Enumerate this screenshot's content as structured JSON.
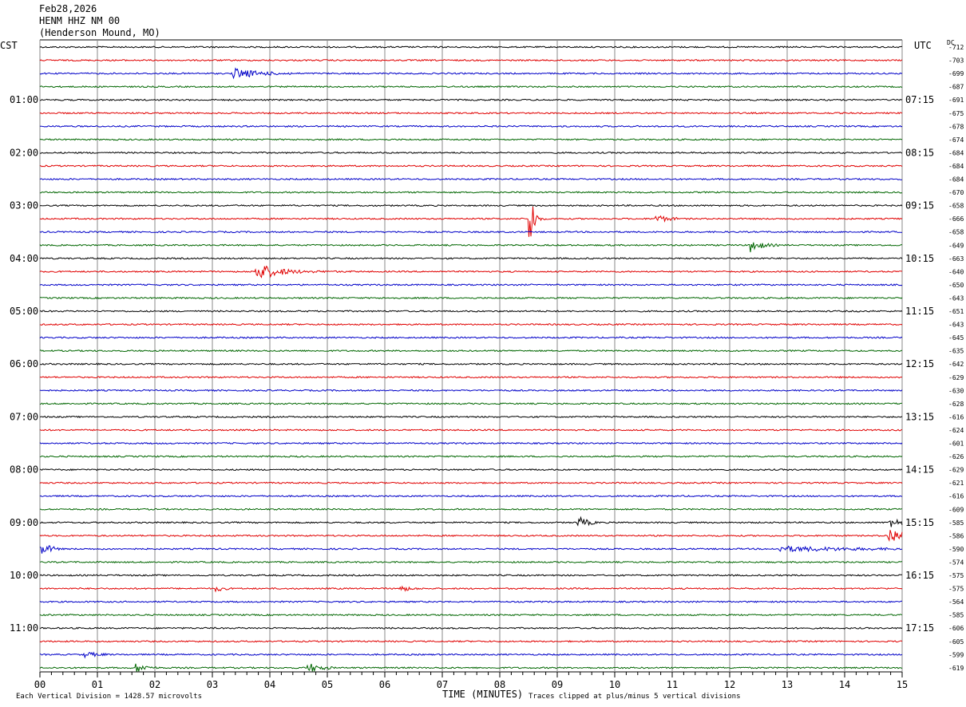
{
  "header": {
    "date": "Feb28,2026",
    "station": "HENM HHZ NM 00",
    "location": "(Henderson Mound, MO)"
  },
  "labels": {
    "left_tz": "CST",
    "right_tz": "UTC",
    "dc": "DC",
    "xlabel": "TIME (MINUTES)",
    "scale_note": "Each Vertical Division = 1428.57 microvolts",
    "clip_note": "Traces clipped at plus/minus 5 vertical divisions"
  },
  "chart_data": {
    "type": "line",
    "x_ticks": [
      "00",
      "01",
      "02",
      "03",
      "04",
      "05",
      "06",
      "07",
      "08",
      "09",
      "10",
      "11",
      "12",
      "13",
      "14",
      "15"
    ],
    "xlim": [
      0,
      15
    ],
    "trace_colors": [
      "#000000",
      "#e00000",
      "#0000c8",
      "#006600"
    ],
    "cst_hours": [
      "01:00",
      "02:00",
      "03:00",
      "04:00",
      "05:00",
      "06:00",
      "07:00",
      "08:00",
      "09:00",
      "10:00",
      "11:00"
    ],
    "utc_hours": [
      "07:15",
      "08:15",
      "09:15",
      "10:15",
      "11:15",
      "12:15",
      "13:15",
      "14:15",
      "15:15",
      "16:15",
      "17:15"
    ],
    "dc_offsets": [
      "-712",
      "-703",
      "-699",
      "-687",
      "-691",
      "-675",
      "-678",
      "-674",
      "-684",
      "-684",
      "-684",
      "-670",
      "-658",
      "-666",
      "-658",
      "-649",
      "-663",
      "-640",
      "-650",
      "-643",
      "-651",
      "-643",
      "-645",
      "-635",
      "-642",
      "-629",
      "-630",
      "-628",
      "-616",
      "-624",
      "-601",
      "-626",
      "-629",
      "-621",
      "-616",
      "-609",
      "-585",
      "-586",
      "-590",
      "-574",
      "-575",
      "-575",
      "-564",
      "-585",
      "-606",
      "-605",
      "-599",
      "-619"
    ],
    "events": [
      {
        "row": 2,
        "minute": 3.4,
        "amp": 6,
        "dur": 1.0,
        "decay": 0.4
      },
      {
        "row": 13,
        "minute": 8.55,
        "amp": 36,
        "dur": 0.25,
        "decay": 0.05
      },
      {
        "row": 13,
        "minute": 10.75,
        "amp": 4,
        "dur": 0.35,
        "decay": 0.2
      },
      {
        "row": 15,
        "minute": 12.4,
        "amp": 8,
        "dur": 0.45,
        "decay": 0.15
      },
      {
        "row": 17,
        "minute": 3.8,
        "amp": 10,
        "dur": 2.2,
        "decay": 0.35
      },
      {
        "row": 36,
        "minute": 9.4,
        "amp": 6,
        "dur": 0.35,
        "decay": 0.15
      },
      {
        "row": 36,
        "minute": 14.8,
        "amp": 5,
        "dur": 0.3,
        "decay": 0.3
      },
      {
        "row": 37,
        "minute": 14.8,
        "amp": 9,
        "dur": 0.3,
        "decay": 0.3
      },
      {
        "row": 38,
        "minute": 0.05,
        "amp": 7,
        "dur": 0.3,
        "decay": 0.15
      },
      {
        "row": 38,
        "minute": 12.9,
        "amp": 3,
        "dur": 2.0,
        "decay": 1.2
      },
      {
        "row": 41,
        "minute": 3.1,
        "amp": 3,
        "dur": 0.25,
        "decay": 0.1
      },
      {
        "row": 41,
        "minute": 6.3,
        "amp": 3,
        "dur": 0.3,
        "decay": 0.15
      },
      {
        "row": 46,
        "minute": 0.8,
        "amp": 3,
        "dur": 0.4,
        "decay": 0.2
      },
      {
        "row": 47,
        "minute": 1.7,
        "amp": 5,
        "dur": 0.35,
        "decay": 0.15
      },
      {
        "row": 47,
        "minute": 4.7,
        "amp": 5,
        "dur": 0.4,
        "decay": 0.2
      }
    ]
  }
}
